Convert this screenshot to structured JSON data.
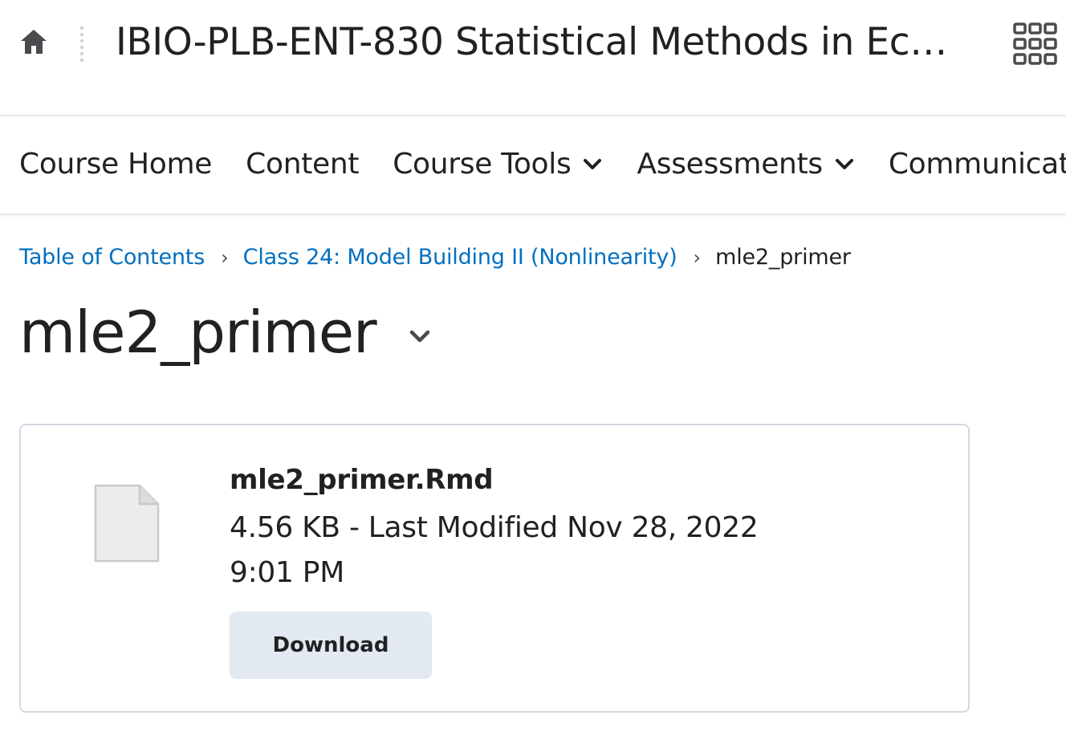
{
  "header": {
    "home_icon": "home-icon",
    "course_title": "IBIO-PLB-ENT-830 Statistical Methods in Ec…",
    "apps_icon": "waffle-grid-icon"
  },
  "nav": {
    "items": [
      {
        "label": "Course Home",
        "has_dropdown": false
      },
      {
        "label": "Content",
        "has_dropdown": false
      },
      {
        "label": "Course Tools",
        "has_dropdown": true
      },
      {
        "label": "Assessments",
        "has_dropdown": true
      },
      {
        "label": "Communication",
        "has_dropdown": false
      }
    ]
  },
  "breadcrumb": {
    "items": [
      {
        "label": "Table of Contents",
        "link": true
      },
      {
        "label": "Class 24: Model Building II (Nonlinearity)",
        "link": true
      },
      {
        "label": "mle2_primer",
        "link": false
      }
    ],
    "separator": "›"
  },
  "page": {
    "title": "mle2_primer"
  },
  "file": {
    "name": "mle2_primer.Rmd",
    "meta": "4.56 KB - Last Modified Nov 28, 2022 9:01 PM",
    "icon": "generic-file-icon",
    "download_label": "Download"
  },
  "colors": {
    "link": "#006fbf",
    "text": "#202122",
    "border": "#d3d9e3",
    "button_bg": "#e3e9f1"
  }
}
